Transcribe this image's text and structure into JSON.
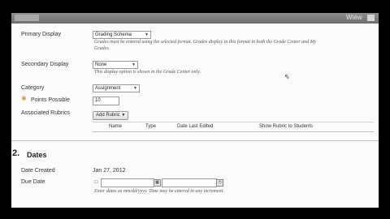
{
  "header": {
    "right_label": "Wiéw"
  },
  "primary_display": {
    "label": "Primary Display",
    "value": "Grading Schema",
    "help": "Grades must be entered using the selected format. Grades display in this format in both the Grade Center and My",
    "help2": "Grades."
  },
  "secondary_display": {
    "label": "Secondary Display",
    "value": "None",
    "help": "This display option is shown in the Grade Center only."
  },
  "category": {
    "label": "Category",
    "value": "Assignment"
  },
  "points_possible": {
    "label": "Points Possible",
    "value": "10"
  },
  "associated_rubrics": {
    "label": "Associated Rubrics",
    "button_label": "Add Rubric",
    "columns": [
      "Name",
      "Type",
      "Date Last Edited",
      "Show Rubric to Students"
    ]
  },
  "dates_section": {
    "number": "2.",
    "title": "Dates",
    "date_created_label": "Date Created",
    "date_created_value": "Jan 27, 2012",
    "due_date_label": "Due Date",
    "due_date_help": "Enter dates as mm/dd/yyyy. Time may be entered in any increment."
  }
}
